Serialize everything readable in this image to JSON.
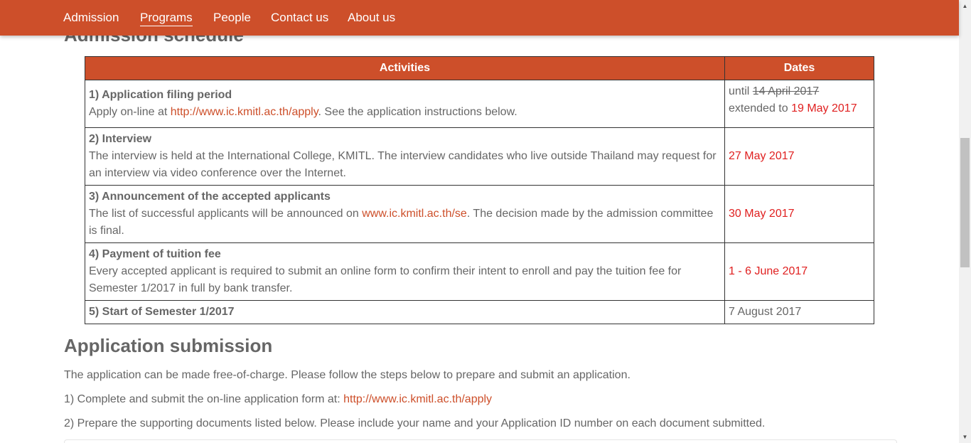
{
  "nav": {
    "items": [
      {
        "label": "Admission"
      },
      {
        "label": "Programs"
      },
      {
        "label": "People"
      },
      {
        "label": "Contact us"
      },
      {
        "label": "About us"
      }
    ]
  },
  "schedule": {
    "title": "Admission schedule",
    "headers": {
      "activities": "Activities",
      "dates": "Dates"
    },
    "rows": [
      {
        "title": "1) Application filing period",
        "desc_before": "Apply on-line at ",
        "link": "http://www.ic.kmitl.ac.th/apply",
        "desc_after": ". See the application instructions below.",
        "date_prefix": "until ",
        "date_struck": "14 April 2017",
        "date_ext_prefix": "extended to ",
        "date_ext": "19 May 2017"
      },
      {
        "title": "2) Interview",
        "desc": "The interview is held at the International College, KMITL. The interview candidates who live outside Thailand may request for an interview via video conference over the Internet.",
        "date": "27 May 2017"
      },
      {
        "title": "3) Announcement of the accepted applicants",
        "desc_before": "The list of successful applicants will be announced on ",
        "link": "www.ic.kmitl.ac.th/se",
        "desc_after": ". The decision made by the admission committee is final.",
        "date": "30 May 2017"
      },
      {
        "title": "4) Payment of tuition fee",
        "desc": "Every accepted applicant is required to submit an online form to confirm their intent to enroll and pay the tuition fee for Semester 1/2017 in full by bank transfer.",
        "date": "1 - 6 June 2017"
      },
      {
        "title": "5) Start of Semester 1/2017",
        "date": "7 August 2017"
      }
    ]
  },
  "submission": {
    "title": "Application submission",
    "intro": "The application can be made free-of-charge. Please follow the steps below to prepare and submit an application.",
    "step1_text": "1)  Complete and submit the on-line application form at: ",
    "step1_link": "http://www.ic.kmitl.ac.th/apply",
    "step2_text": "2)  Prepare the supporting documents listed below. Please include your name and your Application ID number on each document submitted."
  },
  "colors": {
    "accent": "#cd4f2a",
    "date_red": "#e02020",
    "text": "#666666"
  },
  "icons": {
    "scroll_up": "scroll-up-arrow-icon",
    "scroll_down": "scroll-down-arrow-icon"
  }
}
